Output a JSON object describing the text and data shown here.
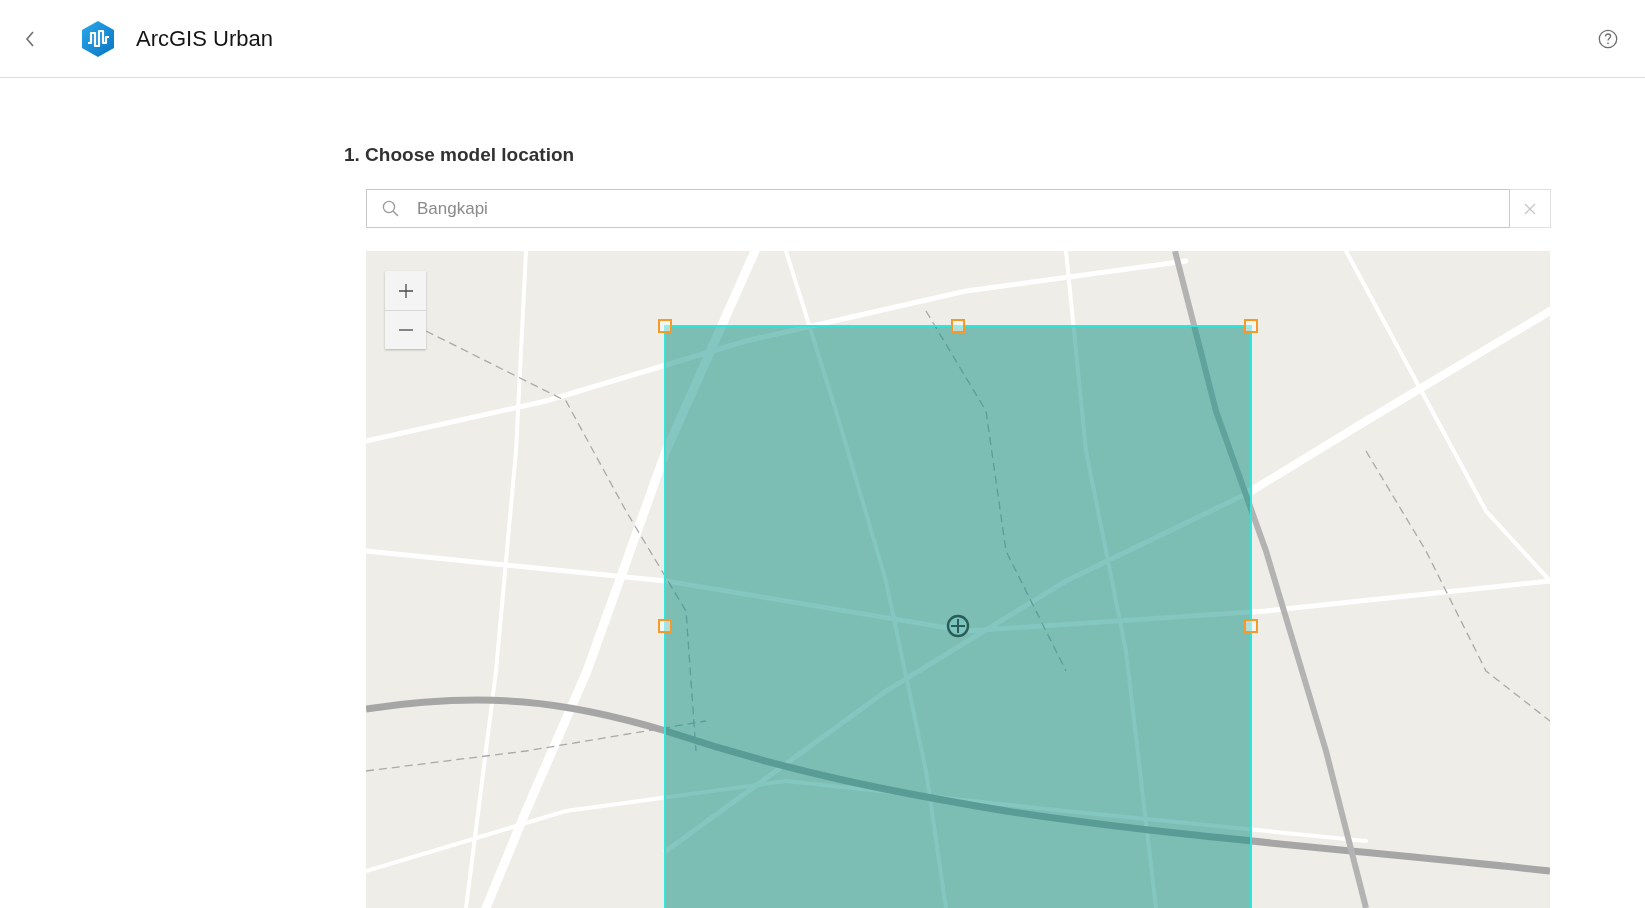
{
  "header": {
    "title": "ArcGIS Urban"
  },
  "step": {
    "heading": "1. Choose model location"
  },
  "search": {
    "value": "Bangkapi"
  }
}
